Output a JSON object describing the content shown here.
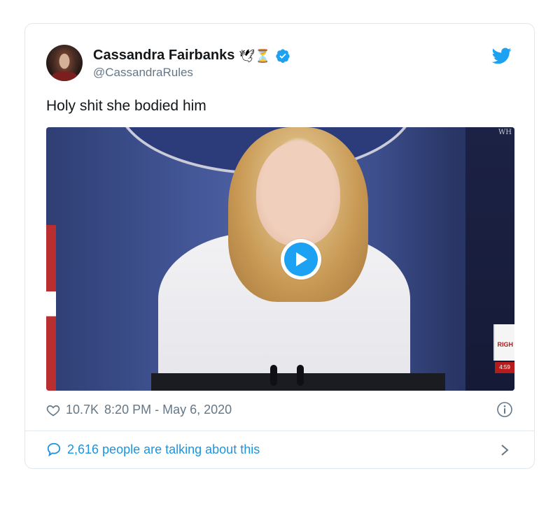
{
  "tweet": {
    "author_name": "Cassandra Fairbanks",
    "author_emojis": "🕊⏳",
    "handle": "@CassandraRules",
    "text": "Holy shit she bodied him",
    "likes": "10.7K",
    "timestamp": "8:20 PM - May 6, 2020",
    "talking_about": "2,616 people are talking about this"
  },
  "media": {
    "corner_text": "WH",
    "logo_text": "RIGH",
    "time_text": "4:59"
  },
  "colors": {
    "twitter_blue": "#1da1f2",
    "link_blue": "#1b95e0",
    "text_dark": "#14171a",
    "text_gray": "#657786",
    "border": "#e1e8ed"
  },
  "icons": {
    "verified": "verified-badge-icon",
    "logo": "twitter-bird-icon",
    "like": "heart-icon",
    "info": "info-icon",
    "replies": "speech-bubble-icon",
    "more": "chevron-right-icon",
    "play": "play-icon"
  }
}
